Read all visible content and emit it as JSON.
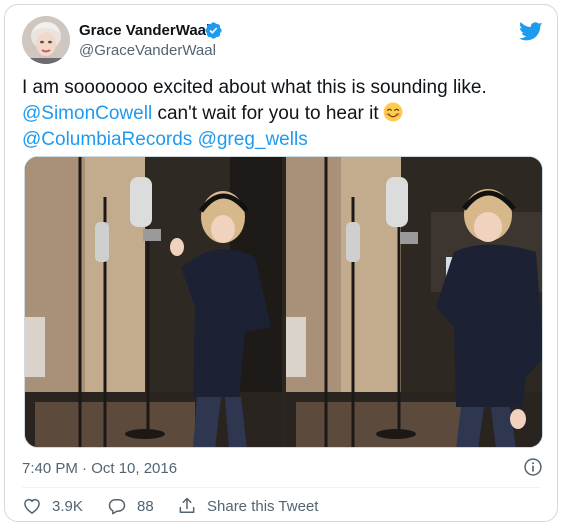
{
  "author": {
    "display_name": "Grace VanderWaal",
    "handle": "@GraceVanderWaal",
    "verified": true
  },
  "tweet": {
    "line1": "I am sooooooo excited about what this is sounding like.",
    "mention_simon": "@SimonCowell",
    "line2_rest": " can't wait for you to hear it",
    "emoji": "smiling-face-with-smiling-eyes",
    "mention_columbia": "@ColumbiaRecords",
    "mention_greg": "@greg_wells"
  },
  "media": {
    "count": 2
  },
  "meta": {
    "timestamp": "7:40 PM · Oct 10, 2016"
  },
  "actions": {
    "like_count": "3.9K",
    "reply_count": "88",
    "share_label": "Share this Tweet"
  },
  "colors": {
    "accent": "#1d9bf0",
    "text": "#0f1419",
    "secondary": "#536471",
    "border": "#cfd9de"
  }
}
